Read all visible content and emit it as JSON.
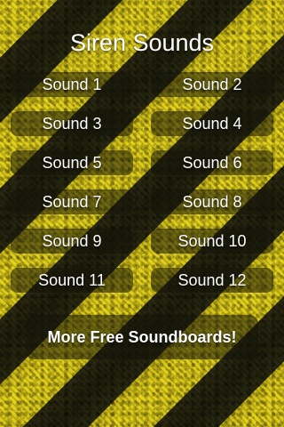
{
  "header": {
    "title": "Siren Sounds"
  },
  "sounds": {
    "buttons": [
      {
        "label": "Sound 1"
      },
      {
        "label": "Sound 2"
      },
      {
        "label": "Sound 3"
      },
      {
        "label": "Sound 4"
      },
      {
        "label": "Sound 5"
      },
      {
        "label": "Sound 6"
      },
      {
        "label": "Sound 7"
      },
      {
        "label": "Sound 8"
      },
      {
        "label": "Sound 9"
      },
      {
        "label": "Sound 10"
      },
      {
        "label": "Sound 11"
      },
      {
        "label": "Sound 12"
      }
    ]
  },
  "footer": {
    "more_label": "More Free Soundboards!"
  },
  "colors": {
    "stripe_yellow": "#e6d41c",
    "stripe_dark": "#1f1f0c",
    "text": "#ffffff"
  }
}
